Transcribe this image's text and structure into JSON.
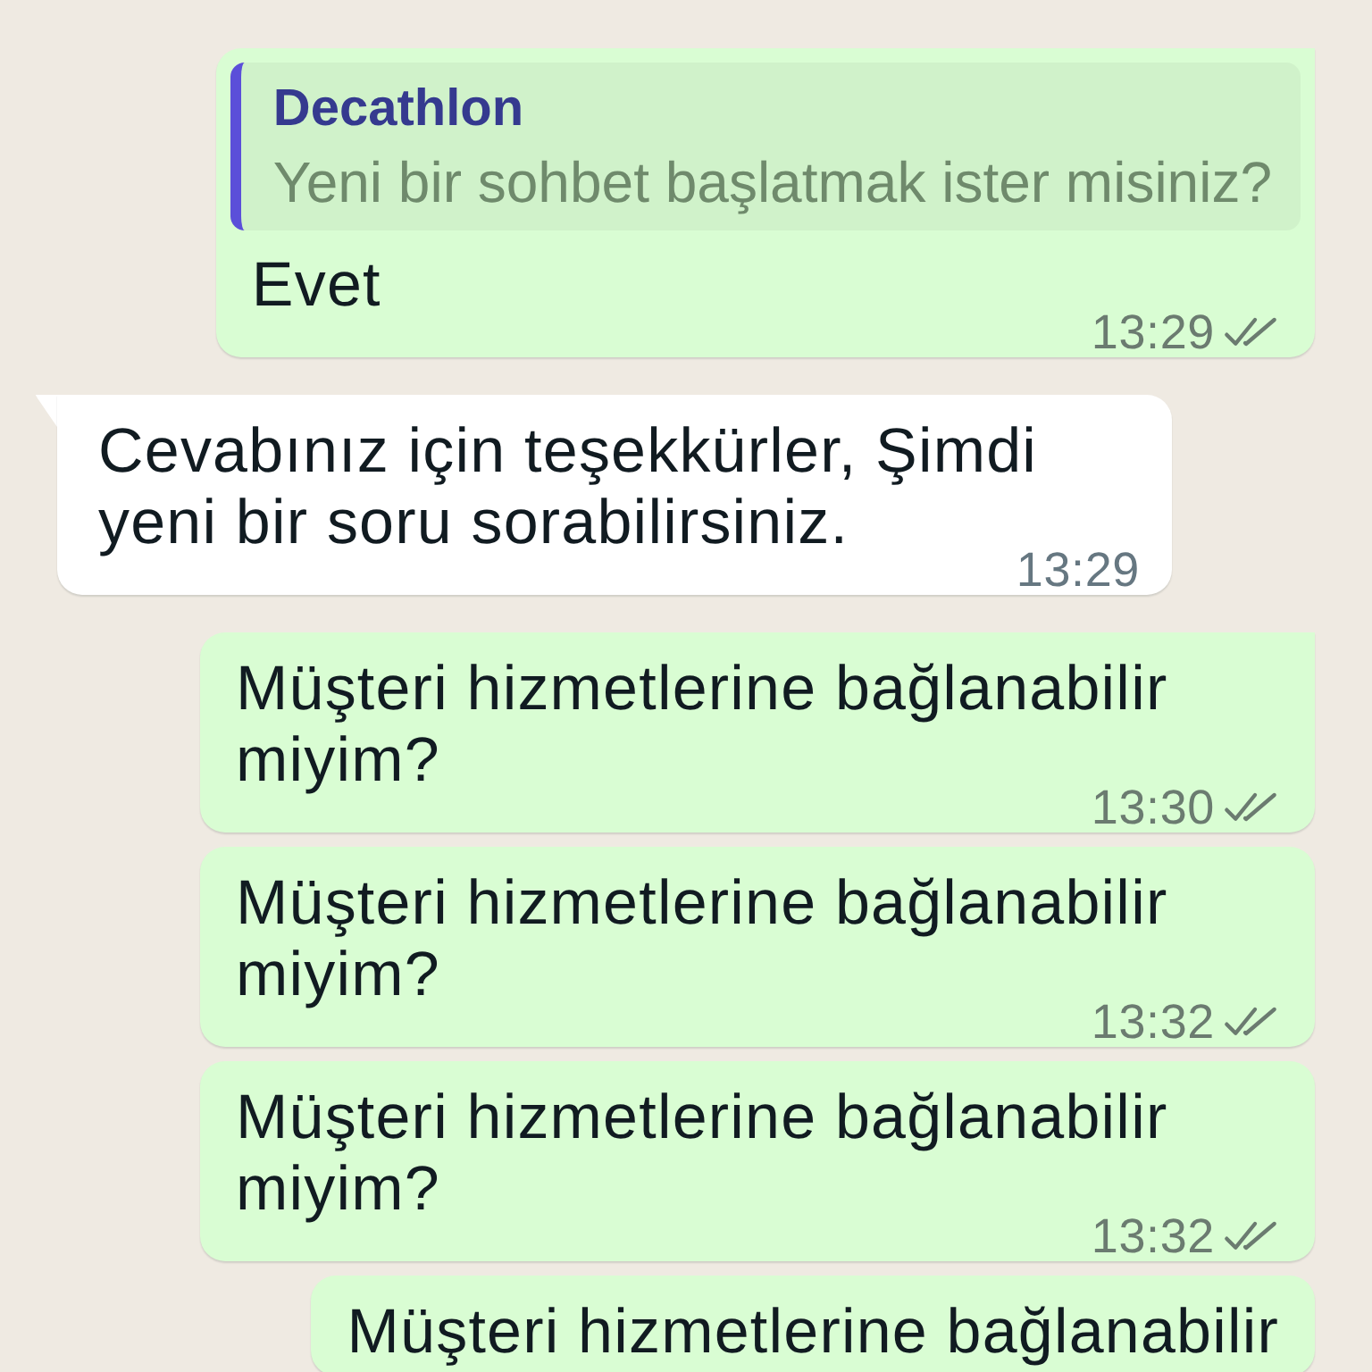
{
  "messages": [
    {
      "kind": "outgoing",
      "quote": {
        "author": "Decathlon",
        "text": "Yeni bir sohbet başlatmak ister misiniz?"
      },
      "text": "Evet",
      "time": "13:29",
      "read": false
    },
    {
      "kind": "incoming",
      "text": "Cevabınız için teşekkürler, Şimdi yeni bir soru sorabilirsiniz.",
      "time": "13:29"
    },
    {
      "kind": "outgoing",
      "text": "Müşteri hizmetlerine bağlanabilir miyim?",
      "time": "13:30",
      "read": false
    },
    {
      "kind": "outgoing",
      "text": "Müşteri hizmetlerine bağlanabilir miyim?",
      "time": "13:32",
      "read": false
    },
    {
      "kind": "outgoing",
      "text": "Müşteri hizmetlerine bağlanabilir miyim?",
      "time": "13:32",
      "read": false
    },
    {
      "kind": "outgoing",
      "text": "Müşteri hizmetlerine bağlanabilir"
    }
  ]
}
